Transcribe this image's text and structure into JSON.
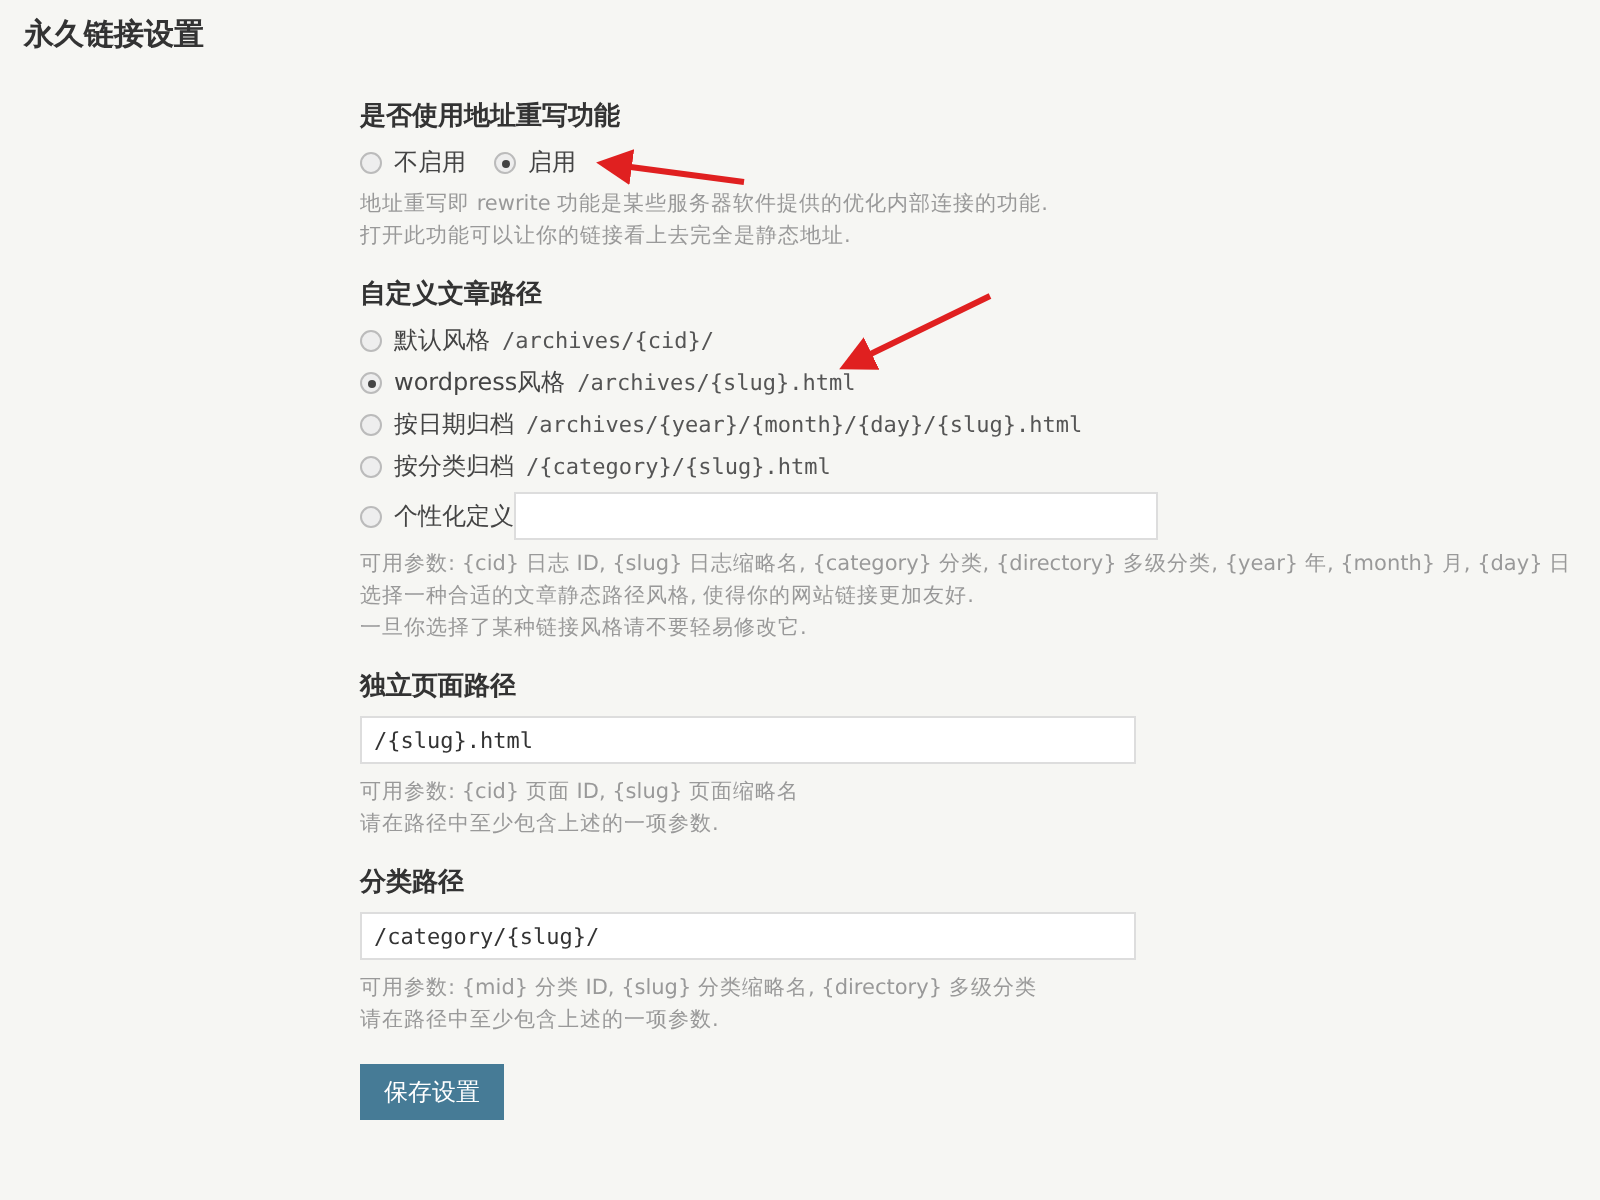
{
  "page_title": "永久链接设置",
  "rewrite": {
    "title": "是否使用地址重写功能",
    "options": [
      {
        "label": "不启用",
        "selected": false
      },
      {
        "label": "启用",
        "selected": true
      }
    ],
    "description": [
      "地址重写即 rewrite 功能是某些服务器软件提供的优化内部连接的功能.",
      "打开此功能可以让你的链接看上去完全是静态地址."
    ]
  },
  "post_path": {
    "title": "自定义文章路径",
    "options": [
      {
        "kind": "preset",
        "label": "默认风格",
        "path": "/archives/{cid}/",
        "selected": false
      },
      {
        "kind": "preset",
        "label": "wordpress风格",
        "path": "/archives/{slug}.html",
        "selected": true
      },
      {
        "kind": "preset",
        "label": "按日期归档",
        "path": "/archives/{year}/{month}/{day}/{slug}.html",
        "selected": false
      },
      {
        "kind": "preset",
        "label": "按分类归档",
        "path": "/{category}/{slug}.html",
        "selected": false
      },
      {
        "kind": "custom",
        "label": "个性化定义",
        "selected": false
      }
    ],
    "description": [
      "可用参数: {cid} 日志 ID, {slug} 日志缩略名, {category} 分类, {directory} 多级分类, {year} 年, {month} 月, {day} 日",
      "选择一种合适的文章静态路径风格, 使得你的网站链接更加友好.",
      "一旦你选择了某种链接风格请不要轻易修改它."
    ]
  },
  "page_path": {
    "title": "独立页面路径",
    "value": "/{slug}.html",
    "description": [
      "可用参数: {cid} 页面 ID, {slug} 页面缩略名",
      "请在路径中至少包含上述的一项参数."
    ]
  },
  "category_path": {
    "title": "分类路径",
    "value": "/category/{slug}/",
    "description": [
      "可用参数: {mid} 分类 ID, {slug} 分类缩略名, {directory} 多级分类",
      "请在路径中至少包含上述的一项参数."
    ]
  },
  "save_button": "保存设置"
}
